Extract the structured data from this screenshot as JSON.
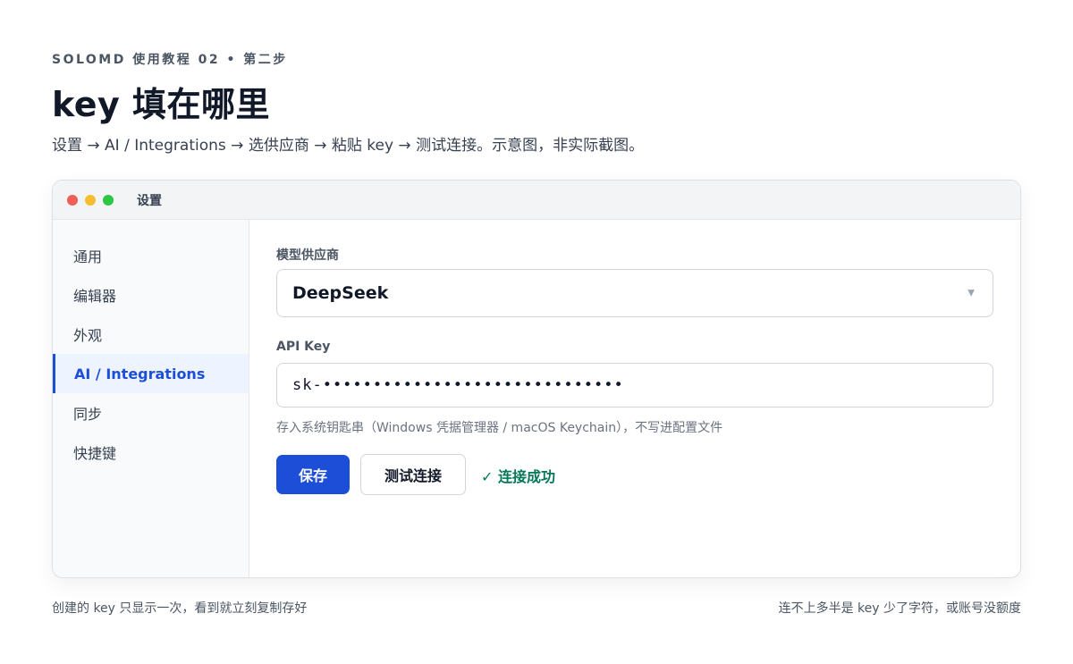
{
  "header": {
    "eyebrow": "SOLOMD 使用教程 02 • 第二步",
    "title": "key 填在哪里",
    "subtitle": "设置 → AI / Integrations → 选供应商 → 粘贴 key → 测试连接。示意图，非实际截图。"
  },
  "window": {
    "title": "设置",
    "controls": [
      "close",
      "minimize",
      "maximize"
    ],
    "colors": {
      "close": "#ef5f56",
      "minimize": "#f6bd2f",
      "maximize": "#2ac840"
    }
  },
  "sidebar": {
    "active_index": 3,
    "items": [
      {
        "label": "通用"
      },
      {
        "label": "编辑器"
      },
      {
        "label": "外观"
      },
      {
        "label": "AI / Integrations"
      },
      {
        "label": "同步"
      },
      {
        "label": "快捷键"
      }
    ]
  },
  "form": {
    "provider_label": "模型供应商",
    "provider_value": "DeepSeek",
    "provider_caret": "▼",
    "api_key_label": "API Key",
    "api_key_value": "sk-••••••••••••••••••••••••••••••",
    "hint": "存入系统钥匙串（Windows 凭据管理器 / macOS Keychain），不写进配置文件",
    "save_label": "保存",
    "test_label": "测试连接",
    "status": "✓ 连接成功"
  },
  "footer": {
    "left": "创建的 key 只显示一次，看到就立刻复制存好",
    "right": "连不上多半是 key 少了字符，或账号没额度"
  },
  "colors": {
    "accent": "#1d4ed8",
    "success": "#047857"
  }
}
